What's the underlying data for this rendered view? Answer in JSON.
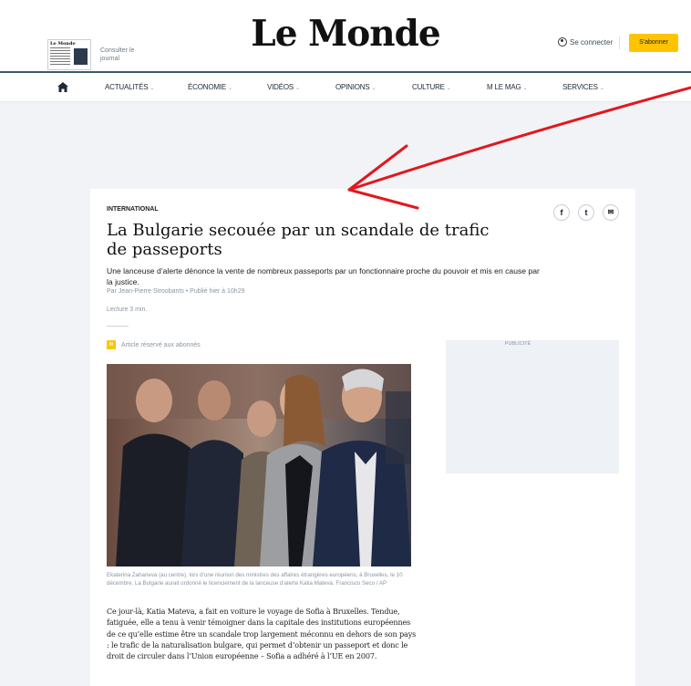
{
  "header": {
    "logo": "Le Monde",
    "paper_link": "Consulter le journal",
    "paper_masthead": "Le Monde",
    "login_label": "Se connecter",
    "subscribe_label": "S'abonner"
  },
  "nav": {
    "items": [
      {
        "label": "ACTUALITÉS",
        "caret": "⌄"
      },
      {
        "label": "ÉCONOMIE",
        "caret": "⌄"
      },
      {
        "label": "VIDÉOS",
        "caret": "⌄"
      },
      {
        "label": "OPINIONS",
        "caret": "⌄"
      },
      {
        "label": "CULTURE",
        "caret": "⌄"
      },
      {
        "label": "M LE MAG",
        "caret": "⌄"
      },
      {
        "label": "SERVICES",
        "caret": "⌄"
      }
    ]
  },
  "article": {
    "section": "INTERNATIONAL",
    "title": "La Bulgarie secouée par un scandale de trafic de passeports",
    "description": "Une lanceuse d’alerte dénonce la vente de nombreux passeports par un fonctionnaire proche du pouvoir et mis en cause par la justice.",
    "byline": "Par Jean-Pierre Stroobants • Publié hier à 10h29",
    "reading_time": "Lecture 3 min.",
    "premium_badge": "M",
    "premium_label": "Article réservé aux abonnés",
    "caption": "Ekaterina Zaharieva (au centre), lors d’une réunion des ministres des affaires étrangères européens, à Bruxelles, le 10 décembre. La Bulgarie aurait ordonné le licenciement de la lanceuse d’alerte Katia Mateva. Francisco Seco / AP",
    "body": "Ce jour-là, Katia Mateva, a fait en voiture le voyage de Sofia à Bruxelles. Tendue, fatiguée, elle a tenu à venir témoigner dans la capitale des institutions européennes de ce qu’elle estime être un scandale trop largement méconnu en dehors de son pays : le trafic de la naturalisation bulgare, qui permet d’obtenir un passeport et donc le droit de circuler dans l’Union européenne – Sofia a adhéré à l’UE en 2007."
  },
  "share": {
    "facebook": "f",
    "twitter": "t",
    "email": "✉"
  },
  "ad": {
    "label": "PUBLICITÉ"
  },
  "colors": {
    "accent": "#ffc400",
    "header_rule": "#3b5a6f",
    "annotation_arrow": "#e0191f"
  },
  "icons": [
    "home-icon",
    "user-icon",
    "facebook-icon",
    "twitter-icon",
    "email-icon",
    "premium-icon"
  ]
}
